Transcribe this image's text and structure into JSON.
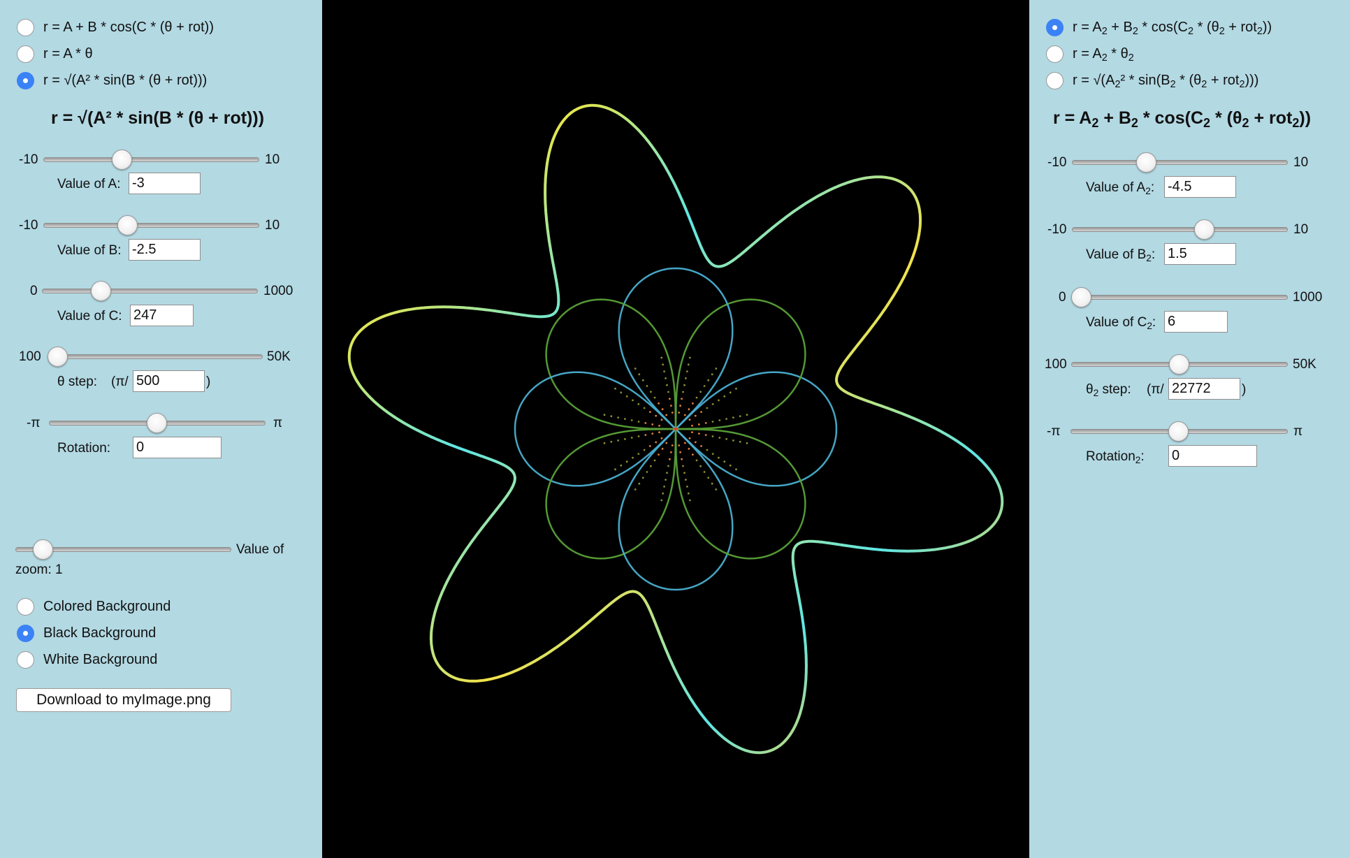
{
  "left": {
    "equations": [
      {
        "label": "r = A + B * cos(C * (θ + rot))",
        "checked": false
      },
      {
        "label": "r = A * θ",
        "checked": false
      },
      {
        "label": "r = √(A² * sin(B * (θ + rot)))",
        "checked": true
      }
    ],
    "formula": "r = √(A² * sin(B * (θ + rot)))",
    "sliders": {
      "a": {
        "min_label": "-10",
        "max_label": "10",
        "value_label": "Value of A:",
        "value": "-3",
        "min": -10,
        "max": 10,
        "current": -3
      },
      "b": {
        "min_label": "-10",
        "max_label": "10",
        "value_label": "Value of B:",
        "value": "-2.5",
        "min": -10,
        "max": 10,
        "current": -2.5
      },
      "c": {
        "min_label": "0",
        "max_label": "1000",
        "value_label": "Value of C:",
        "value": "247",
        "min": 0,
        "max": 1000,
        "current": 247
      },
      "step": {
        "min_label": "100",
        "max_label": "50K",
        "value_label": "θ step:",
        "prefix": "(π/",
        "suffix": ")",
        "value": "500"
      },
      "rotation": {
        "min_label": "-π",
        "max_label": "π",
        "value_label": "Rotation:",
        "value": "0",
        "min": -3.1416,
        "max": 3.1416,
        "current": 0
      }
    },
    "zoom": {
      "label_part1": "Value of",
      "label_part2": "zoom: 1",
      "value": 1
    },
    "backgrounds": [
      {
        "label": "Colored Background",
        "checked": false
      },
      {
        "label": "Black Background",
        "checked": true
      },
      {
        "label": "White Background",
        "checked": false
      }
    ],
    "download_label": "Download to myImage.png"
  },
  "right": {
    "equations": [
      {
        "checked": true
      },
      {
        "checked": false
      },
      {
        "checked": false
      }
    ],
    "sliders": {
      "a2": {
        "min_label": "-10",
        "max_label": "10",
        "value": "-4.5",
        "min": -10,
        "max": 10,
        "current": -4.5
      },
      "b2": {
        "min_label": "-10",
        "max_label": "10",
        "value": "1.5",
        "min": -10,
        "max": 10,
        "current": 1.5
      },
      "c2": {
        "min_label": "0",
        "max_label": "1000",
        "value": "6",
        "min": 0,
        "max": 1000,
        "current": 6
      },
      "step2": {
        "min_label": "100",
        "max_label": "50K",
        "prefix": "(π/",
        "suffix": ")",
        "value": "22772"
      },
      "rotation2": {
        "min_label": "-π",
        "max_label": "π",
        "value": "0",
        "min": -3.1416,
        "max": 3.1416,
        "current": 0
      }
    }
  },
  "colors": {
    "panel": "#b3d9e3",
    "canvas": "#000000",
    "radio_checked": "#3b82f6"
  }
}
